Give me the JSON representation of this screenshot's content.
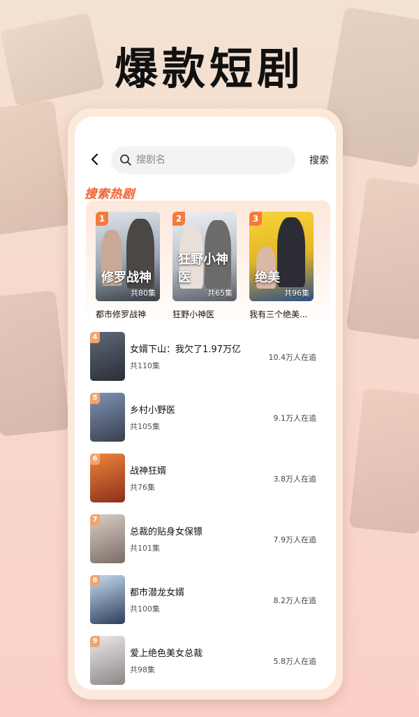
{
  "headline": "爆款短剧",
  "search": {
    "placeholder": "搜剧名",
    "button_label": "搜索"
  },
  "section_title": "搜索热剧",
  "colors": {
    "accent": "#f1683a",
    "rank_top": "#f57a3c",
    "rank_other": "#f3a46c"
  },
  "icons": [
    "back-icon",
    "search-icon"
  ],
  "top3": [
    {
      "rank": "1",
      "title": "都市修罗战神",
      "episodes": "共80集",
      "poster_text": "修罗战神"
    },
    {
      "rank": "2",
      "title": "狂野小神医",
      "episodes": "共65集",
      "poster_text": "狂野小神医"
    },
    {
      "rank": "3",
      "title": "我有三个绝美...",
      "episodes": "共96集",
      "poster_text": "绝美"
    }
  ],
  "list": [
    {
      "rank": "4",
      "title": "女婿下山：我欠了1.97万亿",
      "episodes": "共110集",
      "followers": "10.4万人在追"
    },
    {
      "rank": "5",
      "title": "乡村小野医",
      "episodes": "共105集",
      "followers": "9.1万人在追"
    },
    {
      "rank": "6",
      "title": "战神狂婿",
      "episodes": "共76集",
      "followers": "3.8万人在追"
    },
    {
      "rank": "7",
      "title": "总裁的贴身女保镖",
      "episodes": "共101集",
      "followers": "7.9万人在追"
    },
    {
      "rank": "8",
      "title": "都市潜龙女婿",
      "episodes": "共100集",
      "followers": "8.2万人在追"
    },
    {
      "rank": "9",
      "title": "爱上绝色美女总裁",
      "episodes": "共98集",
      "followers": "5.8万人在追"
    }
  ]
}
